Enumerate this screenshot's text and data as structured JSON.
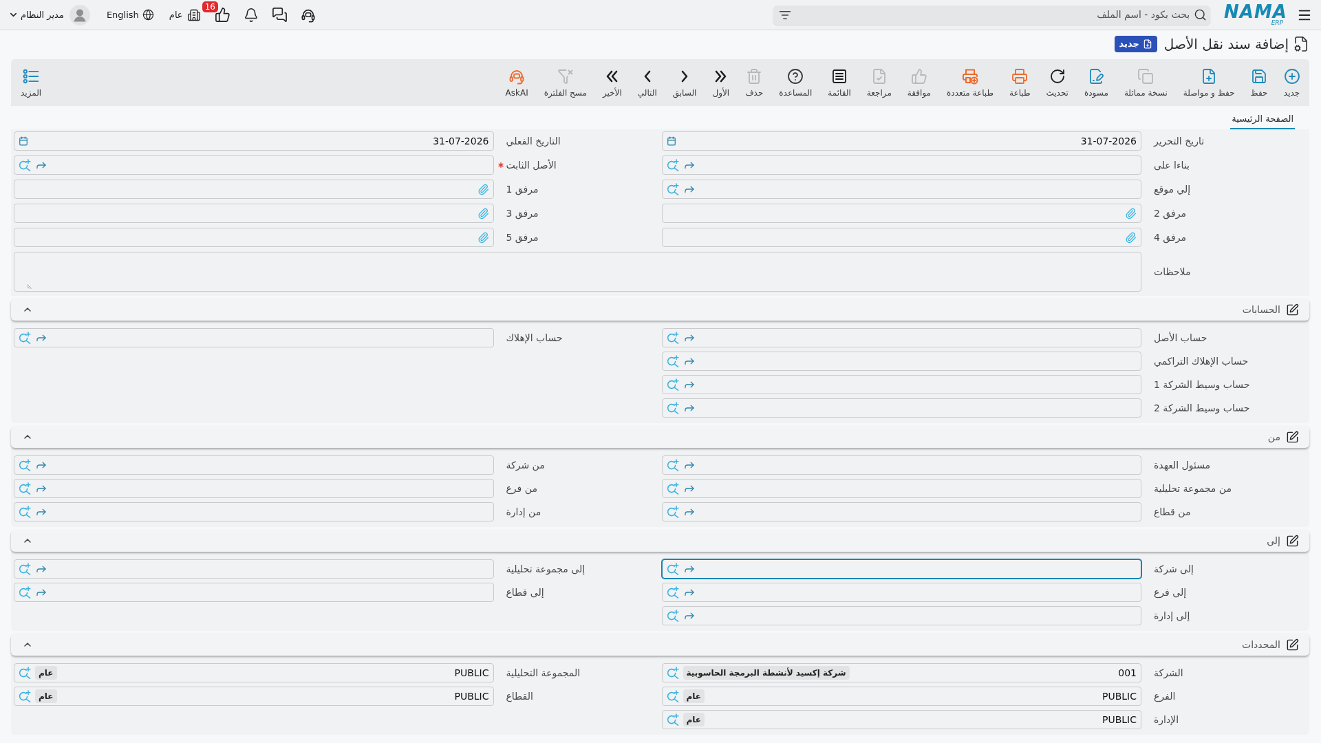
{
  "topbar": {
    "user": {
      "name": "مدير النظام"
    },
    "language": "English",
    "branch": "عام",
    "notification_count": "16",
    "search": {
      "placeholder": "بحث بكود - اسم الملف"
    },
    "logo": {
      "name": "NAMA",
      "sub": "ERP"
    }
  },
  "page": {
    "title": "إضافة سند نقل الأصل",
    "status": "جديد"
  },
  "toolbar": {
    "items": [
      {
        "label": "جديد",
        "kind": "new",
        "color": "#1e8bbd",
        "disabled": false
      },
      {
        "label": "حفظ",
        "kind": "save",
        "color": "#1e8bbd",
        "disabled": false
      },
      {
        "label": "حفظ و مواصلة",
        "kind": "save_continue",
        "color": "#1e8bbd",
        "disabled": false
      },
      {
        "label": "نسخة مماثلة",
        "kind": "duplicate",
        "disabled": true
      },
      {
        "label": "مسودة",
        "kind": "draft",
        "color": "#1e8bbd",
        "disabled": false
      },
      {
        "label": "تحديث",
        "kind": "refresh",
        "color": "#1c1c1c",
        "disabled": false
      },
      {
        "label": "طباعة",
        "kind": "print",
        "color": "#ee6a2c",
        "disabled": false
      },
      {
        "label": "طباعة متعددة",
        "kind": "print_multiple",
        "color": "#ee6a2c",
        "disabled": false
      },
      {
        "label": "موافقة",
        "kind": "approve",
        "disabled": true
      },
      {
        "label": "مراجعة",
        "kind": "review",
        "disabled": true
      },
      {
        "label": "القائمة",
        "kind": "list",
        "color": "#1c1c1c",
        "disabled": false
      },
      {
        "label": "المساعدة",
        "kind": "help",
        "color": "#3a3a3a",
        "disabled": false
      },
      {
        "label": "حذف",
        "kind": "delete",
        "disabled": true
      },
      {
        "label": "الأول",
        "kind": "first",
        "color": "#1c1c1c",
        "disabled": false
      },
      {
        "label": "السابق",
        "kind": "previous",
        "color": "#1c1c1c",
        "disabled": false
      },
      {
        "label": "التالي",
        "kind": "next",
        "color": "#1c1c1c",
        "disabled": false
      },
      {
        "label": "الأخير",
        "kind": "last",
        "color": "#1c1c1c",
        "disabled": false
      },
      {
        "label": "مسح الفلترة",
        "kind": "clear_filter",
        "disabled": true
      },
      {
        "label": "AskAI",
        "kind": "ask_ai",
        "color": "#ee6a2c",
        "disabled": false
      }
    ],
    "more": {
      "label": "المزيد"
    }
  },
  "tabs": [
    {
      "label": "الصفحة الرئيسية",
      "selected": true
    }
  ],
  "main": {
    "columns": [
      [
        {
          "label": "تاريخ التحرير",
          "kind": "date",
          "value": "31-07-2026",
          "required": false,
          "focused": false
        },
        {
          "label": "بناءا على",
          "kind": "lookup",
          "required": false,
          "focused": false
        },
        {
          "label": "إلي موقع",
          "kind": "lookup",
          "required": false,
          "focused": false
        },
        {
          "label": "مرفق 2",
          "kind": "attachment",
          "required": false,
          "focused": false
        },
        {
          "label": "مرفق 4",
          "kind": "attachment",
          "required": false,
          "focused": false
        }
      ],
      [
        {
          "label": "التاريخ الفعلي",
          "kind": "date",
          "value": "31-07-2026",
          "required": false,
          "focused": false
        },
        {
          "label": "الأصل الثابت",
          "kind": "lookup",
          "required": true,
          "focused": false
        },
        {
          "label": "مرفق 1",
          "kind": "attachment",
          "required": false,
          "focused": false
        },
        {
          "label": "مرفق 3",
          "kind": "attachment",
          "required": false,
          "focused": false
        },
        {
          "label": "مرفق 5",
          "kind": "attachment",
          "required": false,
          "focused": false
        }
      ]
    ],
    "notes": {
      "label": "ملاحظات"
    }
  },
  "sections": [
    {
      "title": "الحسابات",
      "expanded": true,
      "columns": [
        [
          {
            "label": "حساب الأصل",
            "kind": "lookup",
            "required": false,
            "focused": false
          },
          {
            "label": "حساب الإهلاك التراكمي",
            "kind": "lookup",
            "required": false,
            "focused": false
          },
          {
            "label": "حساب وسيط الشركة 1",
            "kind": "lookup",
            "required": false,
            "focused": false
          },
          {
            "label": "حساب وسيط الشركة 2",
            "kind": "lookup",
            "required": false,
            "focused": false
          }
        ],
        [
          {
            "label": "حساب الإهلاك",
            "kind": "lookup",
            "required": false,
            "focused": false
          }
        ]
      ]
    },
    {
      "title": "من",
      "expanded": true,
      "columns": [
        [
          {
            "label": "مسئول العهدة",
            "kind": "lookup",
            "required": false,
            "focused": false
          },
          {
            "label": "من مجموعة تحليلية",
            "kind": "lookup",
            "required": false,
            "focused": false
          },
          {
            "label": "من قطاع",
            "kind": "lookup",
            "required": false,
            "focused": false
          }
        ],
        [
          {
            "label": "من شركة",
            "kind": "lookup",
            "required": false,
            "focused": false
          },
          {
            "label": "من فرع",
            "kind": "lookup",
            "required": false,
            "focused": false
          },
          {
            "label": "من إدارة",
            "kind": "lookup",
            "required": false,
            "focused": false
          }
        ]
      ]
    },
    {
      "title": "إلى",
      "expanded": true,
      "columns": [
        [
          {
            "label": "إلى شركة",
            "kind": "lookup",
            "required": false,
            "focused": true
          },
          {
            "label": "إلى فرع",
            "kind": "lookup",
            "required": false,
            "focused": false
          },
          {
            "label": "إلى إدارة",
            "kind": "lookup",
            "required": false,
            "focused": false
          }
        ],
        [
          {
            "label": "إلى مجموعة تحليلية",
            "kind": "lookup",
            "required": false,
            "focused": false
          },
          {
            "label": "إلى قطاع",
            "kind": "lookup",
            "required": false,
            "focused": false
          }
        ]
      ]
    },
    {
      "title": "المحددات",
      "expanded": true,
      "columns": [
        [
          {
            "label": "الشركة",
            "kind": "code",
            "value": "001",
            "chip": "شركة إكسيد لأنشطة البرمجة الحاسوبية",
            "required": false,
            "focused": false
          },
          {
            "label": "الفرع",
            "kind": "code",
            "value": "PUBLIC",
            "chip": "عام",
            "required": false,
            "focused": false
          },
          {
            "label": "الإدارة",
            "kind": "code",
            "value": "PUBLIC",
            "chip": "عام",
            "required": false,
            "focused": false
          }
        ],
        [
          {
            "label": "المجموعة التحليلية",
            "kind": "code",
            "value": "PUBLIC",
            "chip": "عام",
            "required": false,
            "focused": false
          },
          {
            "label": "القطاع",
            "kind": "code",
            "value": "PUBLIC",
            "chip": "عام",
            "required": false,
            "focused": false
          }
        ]
      ]
    }
  ]
}
